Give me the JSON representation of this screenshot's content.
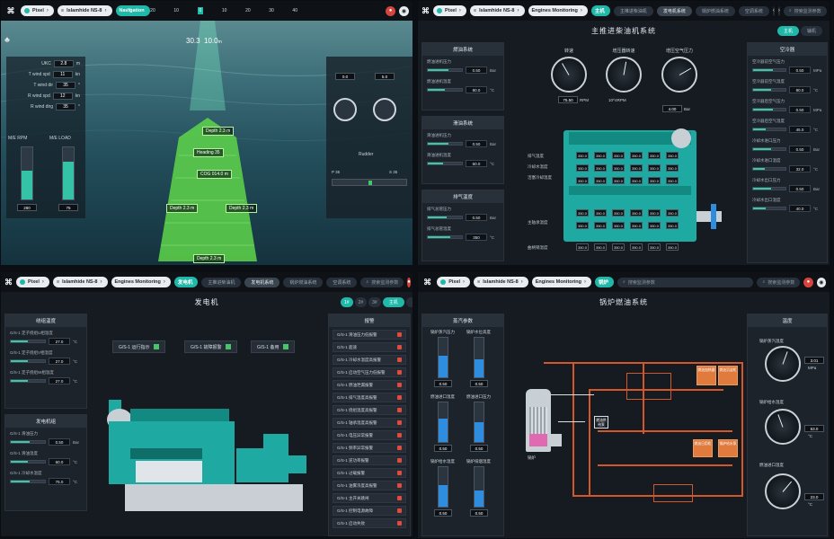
{
  "colors": {
    "accent": "#20b8a8",
    "alarm": "#e14b3e",
    "pipe": "#d2582c",
    "ok": "#44c768"
  },
  "common": {
    "logo_glyph": "⌘",
    "crumb_pixel": "Pixel",
    "search_icon": "search-icon",
    "user_icon": "user-icon",
    "bell_icon": "bell-icon"
  },
  "q1": {
    "crumb_ship": "Islamhide NS-8",
    "crumb_page": "Navigation",
    "compass_ticks": [
      "30",
      "20",
      "10",
      "0",
      "10",
      "20",
      "30",
      "40"
    ],
    "heading": "30.3",
    "speed": "10.0",
    "speed_unit": "m",
    "left_stats": [
      {
        "label": "UKC",
        "value": "2.8",
        "unit": "m"
      },
      {
        "label": "T wind spd",
        "value": "11",
        "unit": "kn"
      },
      {
        "label": "T wind dir",
        "value": "35",
        "unit": "°"
      },
      {
        "label": "R wind spd",
        "value": "12",
        "unit": "kn"
      },
      {
        "label": "R wind dirg",
        "value": "35",
        "unit": "°"
      }
    ],
    "rpm_label": "M/E RPM",
    "load_label": "M/E LOAD",
    "rpm_value": "280",
    "load_value": "75",
    "rpm_fill": 0.55,
    "load_fill": 0.72,
    "right_small_1": "0.0",
    "right_small_2": "5.0",
    "rudder_label": "Rudder",
    "rudder_value": "P 35",
    "rudder_right": "S 35",
    "ship_tags": [
      {
        "label": "Depth",
        "value": "2.3",
        "unit": "m"
      },
      {
        "label": "Heading",
        "value": "35",
        "unit": ""
      },
      {
        "label": "COG",
        "value": "014.0",
        "unit": "m"
      },
      {
        "label": "Depth",
        "value": "2.3",
        "unit": "m"
      },
      {
        "label": "Depth",
        "value": "2.3",
        "unit": "m"
      },
      {
        "label": "Depth",
        "value": "2.3",
        "unit": "m"
      }
    ]
  },
  "q2": {
    "crumb_ship": "Islamhide NS-8",
    "crumb_page": "Engines Monitoring",
    "crumb_sub": "主机",
    "tabs": [
      "主推进柴油机",
      "发电机系统",
      "锅炉燃油系统",
      "空调系统",
      "压载水系统"
    ],
    "active_tab": 1,
    "search": "搜索监测参数",
    "title": "主推进柴油机系统",
    "btn_a": "主机",
    "btn_b": "辅机",
    "left_groups": [
      {
        "title": "燃油系统",
        "items": [
          {
            "label": "燃油进机压力",
            "value": "0.50",
            "unit": "Bar",
            "fill": 0.6
          },
          {
            "label": "燃油进机温度",
            "value": "80.0",
            "unit": "°C",
            "fill": 0.5
          }
        ]
      },
      {
        "title": "滑油系统",
        "items": [
          {
            "label": "滑油进机压力",
            "value": "0.50",
            "unit": "Bar",
            "fill": 0.6
          },
          {
            "label": "滑油进机温度",
            "value": "60.0",
            "unit": "°C",
            "fill": 0.45
          }
        ]
      },
      {
        "title": "排气温度",
        "items": [
          {
            "label": "排气总管压力",
            "value": "0.50",
            "unit": "Bar",
            "fill": 0.55
          },
          {
            "label": "排气总管温度",
            "value": "350",
            "unit": "°C",
            "fill": 0.65
          }
        ]
      }
    ],
    "gauges": [
      {
        "title": "转速",
        "value": "75.50",
        "unit": "RPM",
        "angle": -30
      },
      {
        "title": "增压器转速",
        "value": "10^4RPM",
        "unit": "",
        "angle": 10
      },
      {
        "title": "增压空气压力",
        "value": "4.00",
        "unit": "Bar",
        "angle": 60
      }
    ],
    "cyl_row_labels": [
      "排气温度",
      "冷却水温度",
      "活塞冷却温度"
    ],
    "bottom_labels": [
      "主轴承温度",
      "曲柄销温度"
    ],
    "cells": [
      "350.0",
      "350.0",
      "350.0",
      "350.0",
      "350.0",
      "350.0"
    ],
    "right_title": "空冷器",
    "right_items": [
      {
        "label": "空冷器前空气压力",
        "value": "0.50",
        "unit": "MPa",
        "fill": 0.6
      },
      {
        "label": "空冷器前空气温度",
        "value": "80.0",
        "unit": "°C",
        "fill": 0.55
      },
      {
        "label": "空冷器后空气压力",
        "value": "0.50",
        "unit": "MPa",
        "fill": 0.6
      },
      {
        "label": "空冷器后空气温度",
        "value": "45.0",
        "unit": "°C",
        "fill": 0.4
      },
      {
        "label": "冷却水进口压力",
        "value": "0.50",
        "unit": "Bar",
        "fill": 0.55
      },
      {
        "label": "冷却水进口温度",
        "value": "32.0",
        "unit": "°C",
        "fill": 0.35
      },
      {
        "label": "冷却水出口压力",
        "value": "0.50",
        "unit": "Bar",
        "fill": 0.55
      },
      {
        "label": "冷却水出口温度",
        "value": "40.0",
        "unit": "°C",
        "fill": 0.4
      }
    ]
  },
  "q3": {
    "crumb_ship": "Islamhide NS-8",
    "crumb_page": "Engines Monitoring",
    "crumb_sub": "发电机",
    "tabs": [
      "主推进柴油机",
      "发电机系统",
      "锅炉燃油系统",
      "空调系统",
      "压载水系统"
    ],
    "active_tab": 1,
    "search": "搜索监测参数",
    "title": "发电机",
    "seg": [
      "1#",
      "2#",
      "3#"
    ],
    "btn_a": "主机",
    "btn_b": "辅机",
    "left_groups": [
      {
        "title": "绕组温度",
        "items": [
          {
            "label": "G/S-1 定子绕组U相温度",
            "value": "27.0",
            "unit": "°C",
            "fill": 0.5
          },
          {
            "label": "G/S-1 定子绕组V相温度",
            "value": "27.0",
            "unit": "°C",
            "fill": 0.5
          },
          {
            "label": "G/S-1 定子绕组W相温度",
            "value": "27.0",
            "unit": "°C",
            "fill": 0.5
          }
        ]
      },
      {
        "title": "发电机组",
        "items": [
          {
            "label": "G/S-1 滑油压力",
            "value": "0.50",
            "unit": "Bar",
            "fill": 0.55
          },
          {
            "label": "G/S-1 滑油温度",
            "value": "60.0",
            "unit": "°C",
            "fill": 0.5
          },
          {
            "label": "G/S-1 冷却水温度",
            "value": "75.0",
            "unit": "°C",
            "fill": 0.55
          }
        ]
      }
    ],
    "switches": [
      "G/S-1 运行指示",
      "G/S-1 故障报警",
      "G/S-1 备用"
    ],
    "alarm_title": "报警",
    "alarms": [
      "G/S-1 滑油压力低报警",
      "G/S-1 超速",
      "G/S-1 冷却水温度高报警",
      "G/S-1 启动空气压力低报警",
      "G/S-1 燃油泄漏报警",
      "G/S-1 排气温度高报警",
      "G/S-1 绕组温度高报警",
      "G/S-1 轴承温度高报警",
      "G/S-1 电压异常报警",
      "G/S-1 频率异常报警",
      "G/S-1 逆功率报警",
      "G/S-1 过载报警",
      "G/S-1 油雾浓度高报警",
      "G/S-1 主开关跳闸",
      "G/S-1 控制电源故障",
      "G/S-1 启动失败"
    ]
  },
  "q4": {
    "crumb_ship": "Islamhide NS-8",
    "crumb_page": "Engines Monitoring",
    "crumb_sub": "锅炉",
    "search_a": "搜索监测参数",
    "search_b": "搜索监测参数",
    "title": "锅炉燃油系统",
    "left_title": "蒸汽参数",
    "tanks": [
      {
        "label": "锅炉蒸汽压力",
        "value": "0.50",
        "fill": 0.55
      },
      {
        "label": "锅炉水位高度",
        "value": "0.50",
        "fill": 0.45
      },
      {
        "label": "燃油进口温度",
        "value": "0.50",
        "fill": 0.6
      },
      {
        "label": "燃油进口压力",
        "value": "0.50",
        "fill": 0.5
      },
      {
        "label": "锅炉给水温度",
        "value": "0.50",
        "fill": 0.55
      },
      {
        "label": "锅炉排烟温度",
        "value": "0.50",
        "fill": 0.4
      }
    ],
    "right_title": "温度",
    "gauges": [
      {
        "label": "锅炉蒸汽温度",
        "value": "3.01",
        "unit": "MPa",
        "angle": 20
      },
      {
        "label": "锅炉给水温度",
        "value": "53.0",
        "unit": "°C",
        "angle": -20
      },
      {
        "label": "燃油进口温度",
        "value": "23.0",
        "unit": "°C",
        "angle": 40
      }
    ],
    "boxes": [
      "燃油加热器",
      "燃油沉淀柜",
      "燃油日用柜",
      "锅炉给水泵",
      "燃油供给泵"
    ],
    "boiler_label": "锅炉"
  }
}
